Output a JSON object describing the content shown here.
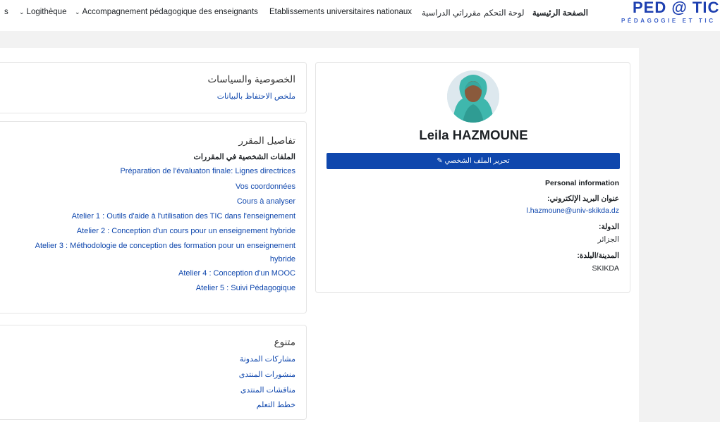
{
  "nav": {
    "items": [
      {
        "label": "s",
        "chevron": false
      },
      {
        "label": "Logithèque",
        "chevron": true
      },
      {
        "label": "Accompagnement pédagogique des enseignants",
        "chevron": true
      },
      {
        "label": "Etablissements universitaires nationaux",
        "chevron": false
      },
      {
        "label": "مقرراتي الدراسية",
        "chevron": false
      },
      {
        "label": "لوحة التحكم",
        "chevron": false
      },
      {
        "label": "الصفحة الرئيسية",
        "chevron": false,
        "active": true
      }
    ],
    "chevron_glyph": "⌄",
    "logo_main": "PED @ TIC",
    "logo_sub": "PÉDAGOGIE ET TIC"
  },
  "privacy": {
    "title": "الخصوصية والسياسات",
    "link": "ملخص الاحتفاظ بالبيانات"
  },
  "course": {
    "title": "تفاصيل المقرر",
    "subtitle": "الملفات الشخصية في المقررات",
    "courses": [
      "Préparation de l'évaluaton finale: Lignes directrices",
      "Vos coordonnées",
      "Cours à analyser",
      "Atelier 1 : Outils d'aide à l'utilisation des TIC dans l'enseignement",
      "Atelier 2 : Conception d'un cours pour un enseignement hybride",
      "Atelier 3 : Méthodologie de conception des formation pour un enseignement",
      "hybride",
      "Atelier 4 : Conception d'un MOOC",
      "Atelier 5 : Suivi Pédagogique"
    ]
  },
  "misc": {
    "title": "متنوع",
    "links": [
      "مشاركات المدونة",
      "منشورات المنتدى",
      "مناقشات المنتدى",
      "خطط التعلم"
    ]
  },
  "profile": {
    "name": "Leila HAZMOUNE",
    "edit_button": "تحرير الملف الشخصي",
    "edit_icon": "edit-icon",
    "section": "Personal information",
    "email_label": "عنوان البريد الإلكتروني:",
    "email": "l.hazmoune@univ-skikda.dz",
    "country_label": "الدولة:",
    "country": "الجزائر",
    "city_label": "المدينة/البلدة:",
    "city": "SKIKDA"
  },
  "colors": {
    "link": "#0f47ad",
    "button": "#0f47ad",
    "logo": "#1e40b0"
  }
}
